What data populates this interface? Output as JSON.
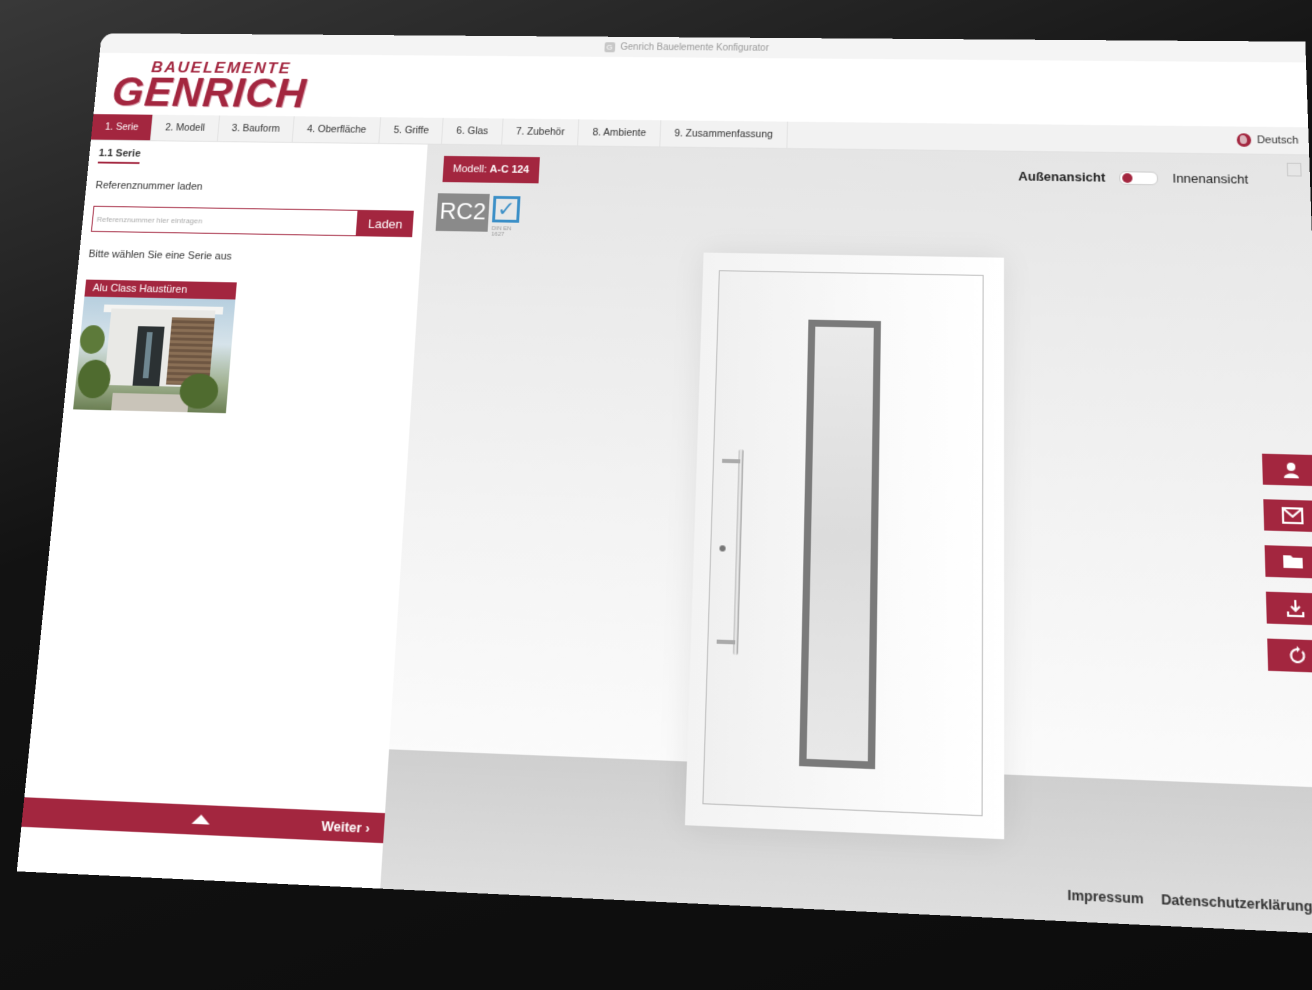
{
  "window": {
    "title": "Genrich Bauelemente Konfigurator"
  },
  "logo": {
    "top": "BAUELEMENTE",
    "main": "GENRICH"
  },
  "nav": {
    "tabs": [
      {
        "label": "1. Serie"
      },
      {
        "label": "2. Modell"
      },
      {
        "label": "3. Bauform"
      },
      {
        "label": "4. Oberfläche"
      },
      {
        "label": "5. Griffe"
      },
      {
        "label": "6. Glas"
      },
      {
        "label": "7. Zubehör"
      },
      {
        "label": "8. Ambiente"
      },
      {
        "label": "9. Zusammenfassung"
      }
    ],
    "language": "Deutsch"
  },
  "sidebar": {
    "subtab": "1.1 Serie",
    "ref_label": "Referenznummer laden",
    "ref_placeholder": "Referenznummer hier eintragen",
    "load_button": "Laden",
    "series_prompt": "Bitte wählen Sie eine Serie aus",
    "series_card": "Alu Class Haustüren",
    "next_button": "Weiter ›"
  },
  "stage": {
    "model_prefix": "Modell:",
    "model_value": "A-C 124",
    "rc2": "RC2",
    "rc2_norm": "DIN EN 1627",
    "view_outside": "Außenansicht",
    "view_inside": "Innenansicht"
  },
  "footer": {
    "impressum": "Impressum",
    "privacy": "Datenschutzerklärung"
  },
  "colors": {
    "brand": "#a3263f"
  }
}
